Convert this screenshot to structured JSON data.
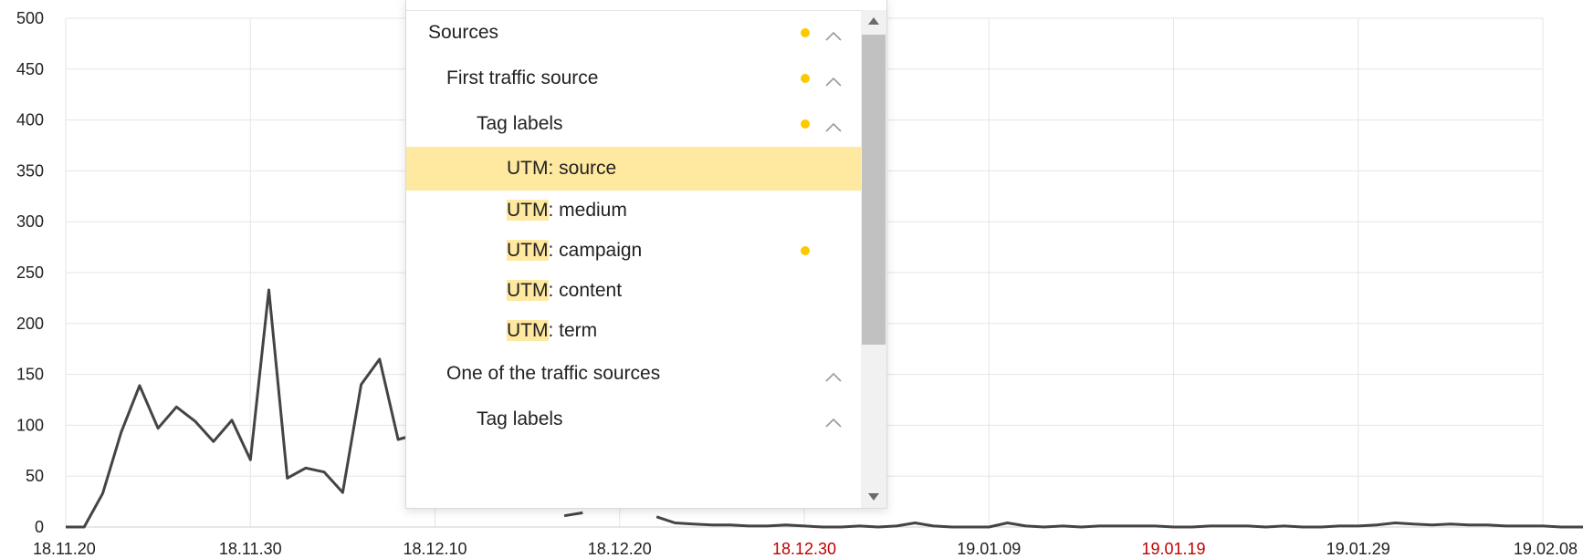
{
  "chart_data": {
    "type": "line",
    "x_tick_labels": [
      "18.11.20",
      "18.11.30",
      "18.12.10",
      "18.12.20",
      "18.12.30",
      "19.01.09",
      "19.01.19",
      "19.01.29",
      "19.02.08"
    ],
    "x_tick_holiday_color": "#c00000",
    "x_tick_holidays": [
      "18.12.30",
      "19.01.19"
    ],
    "y_ticks": [
      0,
      50,
      100,
      150,
      200,
      250,
      300,
      350,
      400,
      450,
      500
    ],
    "ylim": [
      0,
      500
    ],
    "grid": true,
    "line_color": "#444444",
    "series": [
      {
        "values": [
          0,
          0,
          33,
          93,
          139,
          97,
          118,
          104,
          84,
          105,
          66,
          233,
          48,
          58,
          54,
          34,
          140,
          165,
          86,
          91,
          null,
          null,
          null,
          null,
          null,
          null,
          null,
          null,
          null,
          null,
          null,
          null,
          null,
          null,
          null,
          null,
          null,
          null,
          null,
          null,
          null,
          null,
          null,
          null,
          null,
          null,
          null,
          null,
          null,
          null,
          null,
          null,
          null,
          null,
          null,
          null,
          null,
          null,
          null,
          null,
          null,
          null,
          null,
          null,
          null,
          null,
          null,
          null,
          null,
          null,
          null,
          null,
          null,
          null,
          null,
          null,
          null,
          null,
          null,
          null,
          null,
          null,
          null,
          null
        ]
      },
      {
        "values": [
          null,
          null,
          null,
          null,
          null,
          null,
          null,
          null,
          null,
          null,
          null,
          null,
          null,
          null,
          null,
          null,
          null,
          null,
          null,
          null,
          null,
          null,
          null,
          null,
          null,
          null,
          null,
          null,
          null,
          null,
          null,
          null,
          null,
          null,
          null,
          null,
          null,
          null,
          null,
          null,
          null,
          null,
          null,
          null,
          null,
          null,
          null,
          null,
          null,
          null,
          null,
          null,
          null,
          null,
          null,
          null,
          null,
          null,
          null,
          null,
          null,
          null,
          null,
          null,
          null,
          null,
          null,
          null,
          null,
          null,
          null,
          null,
          null,
          null,
          null,
          null,
          null,
          null,
          null,
          null,
          null,
          null,
          null,
          null
        ]
      }
    ],
    "visible_segments": [
      {
        "x_days": [
          0,
          1,
          2,
          3,
          4,
          5,
          6,
          7,
          8,
          9,
          10,
          11,
          12,
          13,
          14,
          15,
          16,
          17,
          18,
          19
        ],
        "values": [
          0,
          0,
          33,
          93,
          139,
          97,
          118,
          104,
          84,
          105,
          66,
          233,
          48,
          58,
          54,
          34,
          140,
          165,
          86,
          91
        ]
      },
      {
        "x_days": [
          27,
          28
        ],
        "values": [
          11,
          14
        ]
      },
      {
        "x_days": [
          32,
          33,
          34,
          35,
          36,
          37,
          38,
          39,
          40,
          41,
          42,
          43,
          44,
          45,
          46,
          47,
          48,
          49,
          50,
          51,
          52,
          53,
          54,
          55,
          56,
          57,
          58,
          59,
          60,
          61,
          62,
          63,
          64,
          65,
          66,
          67,
          68,
          69,
          70,
          71,
          72,
          73,
          74,
          75,
          76,
          77,
          78,
          79,
          80,
          81,
          82,
          83,
          84
        ],
        "values": [
          10,
          4,
          3,
          2,
          2,
          1,
          1,
          2,
          1,
          0,
          0,
          1,
          0,
          1,
          4,
          1,
          0,
          0,
          0,
          4,
          1,
          0,
          1,
          0,
          1,
          1,
          1,
          1,
          0,
          0,
          1,
          1,
          1,
          0,
          1,
          0,
          0,
          1,
          1,
          2,
          4,
          3,
          2,
          3,
          2,
          2,
          1,
          1,
          1,
          0,
          0,
          0,
          0
        ]
      }
    ]
  },
  "dropdown": {
    "items": [
      {
        "label": "Sources",
        "level": 0,
        "dot": true,
        "chevron": true
      },
      {
        "label": "First traffic source",
        "level": 1,
        "dot": true,
        "chevron": true
      },
      {
        "label": "Tag labels",
        "level": 2,
        "dot": true,
        "chevron": true
      },
      {
        "label_hl": "UTM",
        "label_rest": ": source",
        "level": 3,
        "dot": false,
        "chevron": false,
        "selected": true
      },
      {
        "label_hl": "UTM",
        "label_rest": ": medium",
        "level": 3,
        "dot": false,
        "chevron": false
      },
      {
        "label_hl": "UTM",
        "label_rest": ": campaign",
        "level": 3,
        "dot": true,
        "chevron": false
      },
      {
        "label_hl": "UTM",
        "label_rest": ": content",
        "level": 3,
        "dot": false,
        "chevron": false
      },
      {
        "label_hl": "UTM",
        "label_rest": ": term",
        "level": 3,
        "dot": false,
        "chevron": false
      },
      {
        "label": "One of the traffic sources",
        "level": 1,
        "dot": false,
        "chevron": true
      },
      {
        "label": "Tag labels",
        "level": 2,
        "dot": false,
        "chevron": true
      }
    ],
    "accent_dot_color": "#fcc900",
    "highlight_color": "#ffe9a0",
    "scroll_up_icon": "triangle-up-icon",
    "scroll_down_icon": "triangle-down-icon",
    "chevron_icon": "chevron-up-icon"
  }
}
